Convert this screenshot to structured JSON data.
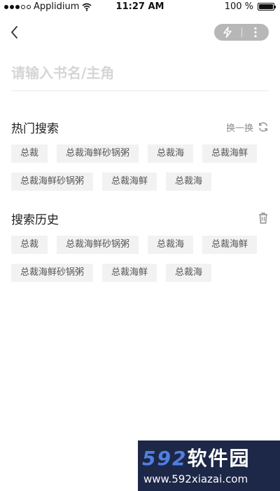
{
  "status_bar": {
    "carrier": "Applidium",
    "time": "11:27 AM",
    "battery_text": "100 %",
    "battery_level": 1.0
  },
  "nav": {
    "back_icon": "chevron-left-icon",
    "capsule_icons": [
      "flash-icon",
      "more-vertical-icon"
    ]
  },
  "search": {
    "placeholder": "请输入书名/主角",
    "value": ""
  },
  "hot": {
    "title": "热门搜索",
    "refresh_label": "换一换",
    "tags": [
      "总裁",
      "总裁海鲜砂锅粥",
      "总裁海",
      "总裁海鲜",
      "总裁海鲜砂锅粥",
      "总裁海鲜",
      "总裁海"
    ]
  },
  "history": {
    "title": "搜索历史",
    "tags": [
      "总裁",
      "总裁海鲜砂锅粥",
      "总裁海",
      "总裁海鲜",
      "总裁海鲜砂锅粥",
      "总裁海鲜",
      "总裁海"
    ]
  },
  "watermark": {
    "logo_num": "592",
    "logo_cn": "软件园",
    "url": "www.592xiazai.com"
  }
}
